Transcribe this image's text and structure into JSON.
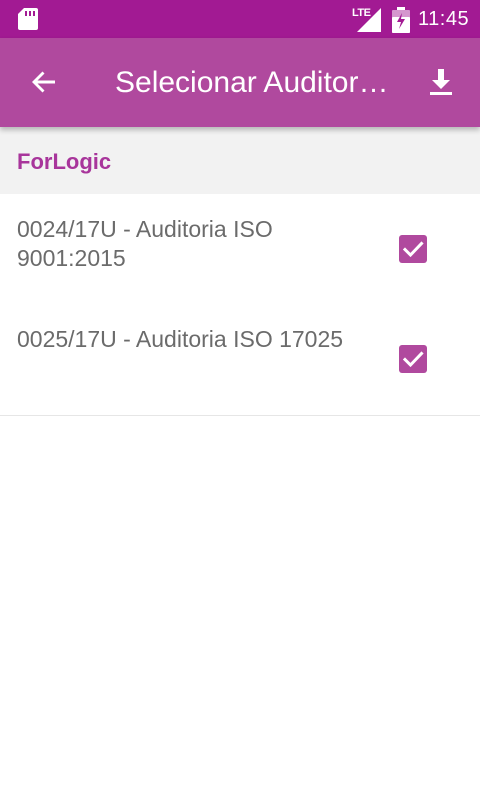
{
  "status_bar": {
    "time": "11:45",
    "network": "LTE",
    "icons": [
      "sd-card-icon",
      "signal-icon",
      "battery-charging-icon"
    ]
  },
  "app_bar": {
    "title": "Selecionar Auditorias",
    "back_icon": "arrow-back-icon",
    "action_icon": "download-icon"
  },
  "group": {
    "name": "ForLogic"
  },
  "items": [
    {
      "label": "0024/17U - Auditoria ISO 9001:2015",
      "checked": true
    },
    {
      "label": "0025/17U - Auditoria ISO 17025",
      "checked": true
    }
  ],
  "colors": {
    "status_bar": "#a21a93",
    "app_bar": "#b0499e",
    "accent": "#a8359b",
    "group_bg": "#f2f2f2",
    "item_text": "#6b6b6b"
  }
}
